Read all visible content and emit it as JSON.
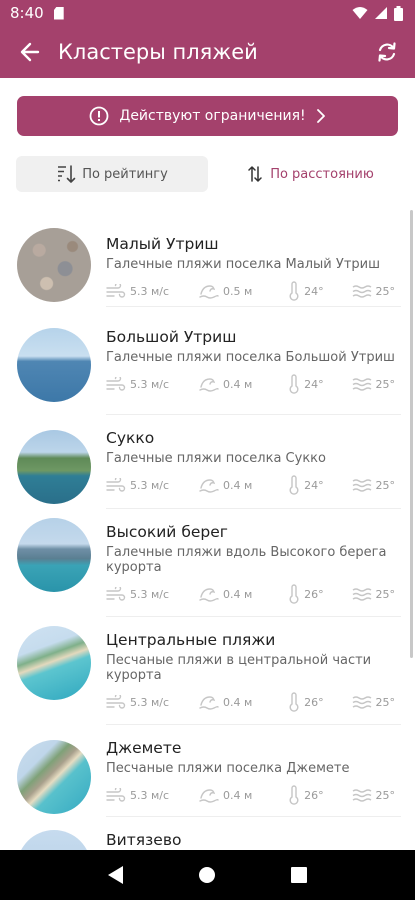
{
  "status_bar": {
    "time": "8:40",
    "icons": [
      "sd-card-icon",
      "wifi-icon",
      "signal-icon",
      "battery-icon"
    ]
  },
  "app_bar": {
    "title": "Кластеры пляжей",
    "back_icon": "arrow-left-icon",
    "refresh_icon": "refresh-icon"
  },
  "colors": {
    "accent": "#a4416c",
    "text": "#222222",
    "secondary": "#666666",
    "stat": "#9a9a9a"
  },
  "warning": {
    "label": "Действуют ограничения!",
    "icon": "info-circle-icon",
    "chevron": "chevron-right-icon"
  },
  "sort": {
    "rating_label": "По рейтингу",
    "distance_label": "По расстоянию"
  },
  "beaches": [
    {
      "name": "Малый Утриш",
      "description": "Галечные пляжи поселка Малый Утриш",
      "wind": "5.3 м/с",
      "wave": "0.5 м",
      "air": "24°",
      "water": "25°"
    },
    {
      "name": "Большой Утриш",
      "description": "Галечные пляжи поселка Большой Утриш",
      "wind": "5.3 м/с",
      "wave": "0.4 м",
      "air": "24°",
      "water": "25°"
    },
    {
      "name": "Сукко",
      "description": "Галечные пляжи поселка Сукко",
      "wind": "5.3 м/с",
      "wave": "0.4 м",
      "air": "24°",
      "water": "25°"
    },
    {
      "name": "Высокий берег",
      "description": "Галечные пляжи вдоль Высокого берега курорта",
      "wind": "5.3 м/с",
      "wave": "0.4 м",
      "air": "26°",
      "water": "25°"
    },
    {
      "name": "Центральные пляжи",
      "description": "Песчаные пляжи в центральной части курорта",
      "wind": "5.3 м/с",
      "wave": "0.4 м",
      "air": "26°",
      "water": "25°"
    },
    {
      "name": "Джемете",
      "description": "Песчаные пляжи поселка Джемете",
      "wind": "5.3 м/с",
      "wave": "0.4 м",
      "air": "26°",
      "water": "25°"
    },
    {
      "name": "Витязево",
      "description": "",
      "wind": "",
      "wave": "",
      "air": "",
      "water": ""
    }
  ],
  "nav_bar": {
    "icons": [
      "back-triangle-icon",
      "home-circle-icon",
      "recents-square-icon"
    ]
  }
}
